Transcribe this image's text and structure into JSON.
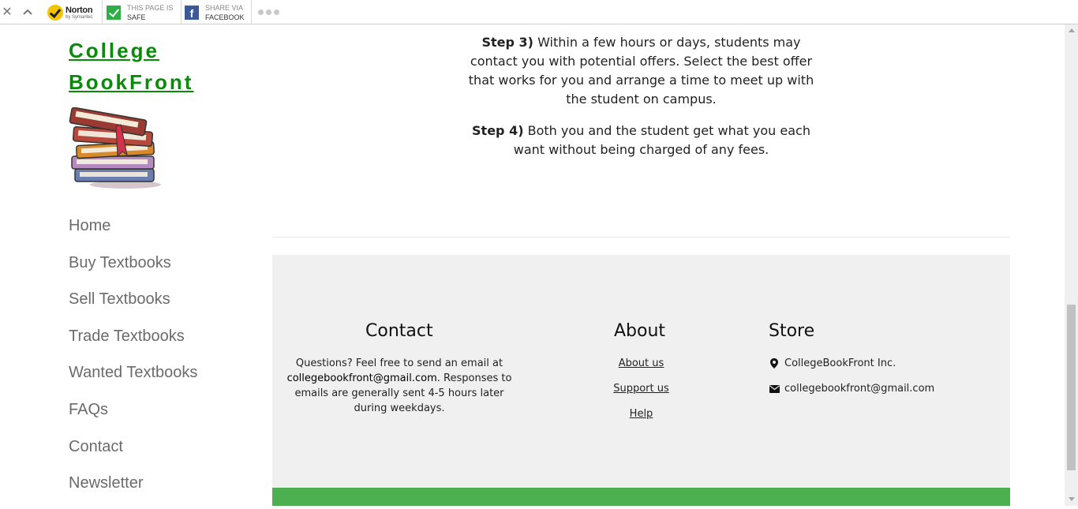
{
  "toolbar": {
    "close_icon": "close-icon",
    "collapse_icon": "chevron-up-icon",
    "norton_name": "Norton",
    "norton_sub": "by Symantec",
    "safe_line1": "THIS PAGE IS",
    "safe_line2": "SAFE",
    "share_line1": "SHARE VIA",
    "share_line2": "FACEBOOK",
    "fb_letter": "f"
  },
  "sidebar": {
    "brand_line1": "College",
    "brand_line2": "BookFront",
    "nav": [
      "Home",
      "Buy Textbooks",
      "Sell Textbooks",
      "Trade Textbooks",
      "Wanted Textbooks",
      "FAQs",
      "Contact",
      "Newsletter"
    ]
  },
  "steps": {
    "step3_label": "Step 3)",
    "step3_text": "Within a few hours or days, students may contact you with potential offers. Select the best offer that works for you and arrange a time to meet up with the student on campus.",
    "step4_label": "Step 4)",
    "step4_text": "Both you and the student get what you each want without being charged of any fees."
  },
  "footer": {
    "contact_title": "Contact",
    "contact_pre": "Questions? Feel free to send an email at",
    "contact_email": "collegebookfront@gmail.com",
    "contact_post": ". Responses to emails are generally sent 4-5 hours later during weekdays.",
    "about_title": "About",
    "about_links": [
      "About us",
      "Support us",
      "Help"
    ],
    "store_title": "Store",
    "store_company": "CollegeBookFront Inc.",
    "store_email": "collegebookfront@gmail.com"
  },
  "colors": {
    "brand_green": "#0a8a0a",
    "footer_bg": "#f0f0f0",
    "footer_bar": "#4caf50",
    "nav_text": "#6b6b6b"
  }
}
